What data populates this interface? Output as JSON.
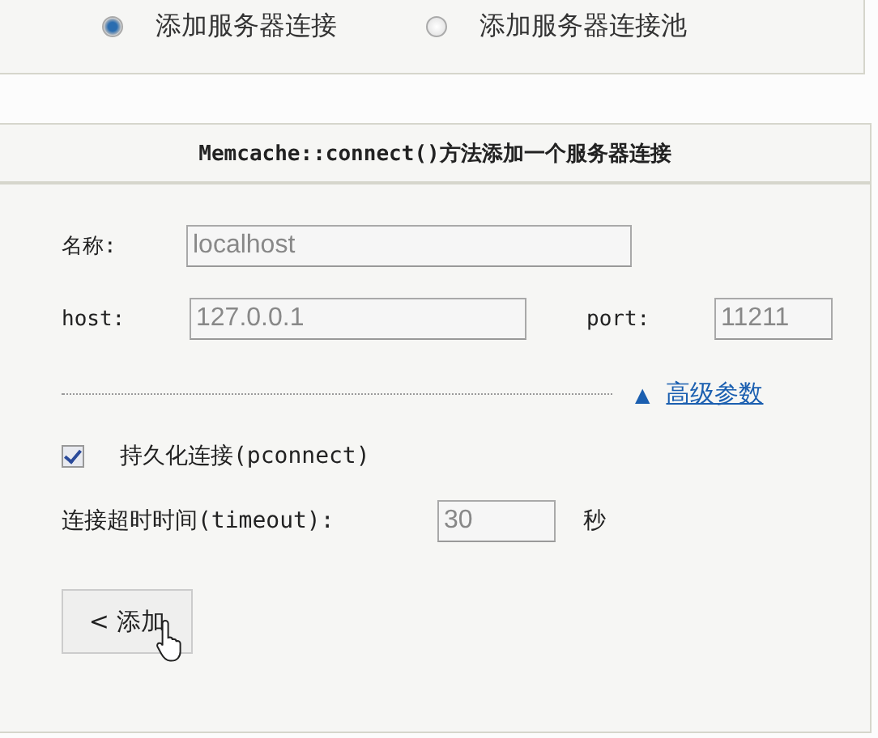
{
  "mode_options": [
    {
      "label": "添加服务器连接",
      "selected": true
    },
    {
      "label": "添加服务器连接池",
      "selected": false
    }
  ],
  "panel": {
    "title": "Memcache::connect()方法添加一个服务器连接",
    "name_field": {
      "label": "名称:",
      "value": "localhost"
    },
    "host_field": {
      "label": "host:",
      "value": "127.0.0.1"
    },
    "port_field": {
      "label": "port:",
      "value": "11211"
    },
    "advanced_link": {
      "icon": "▲",
      "label": "高级参数"
    },
    "pconnect": {
      "label": "持久化连接(pconnect)",
      "checked": true
    },
    "timeout": {
      "label": "连接超时时间(timeout):",
      "value": "30",
      "unit": "秒"
    },
    "add_button": "< 添加"
  }
}
